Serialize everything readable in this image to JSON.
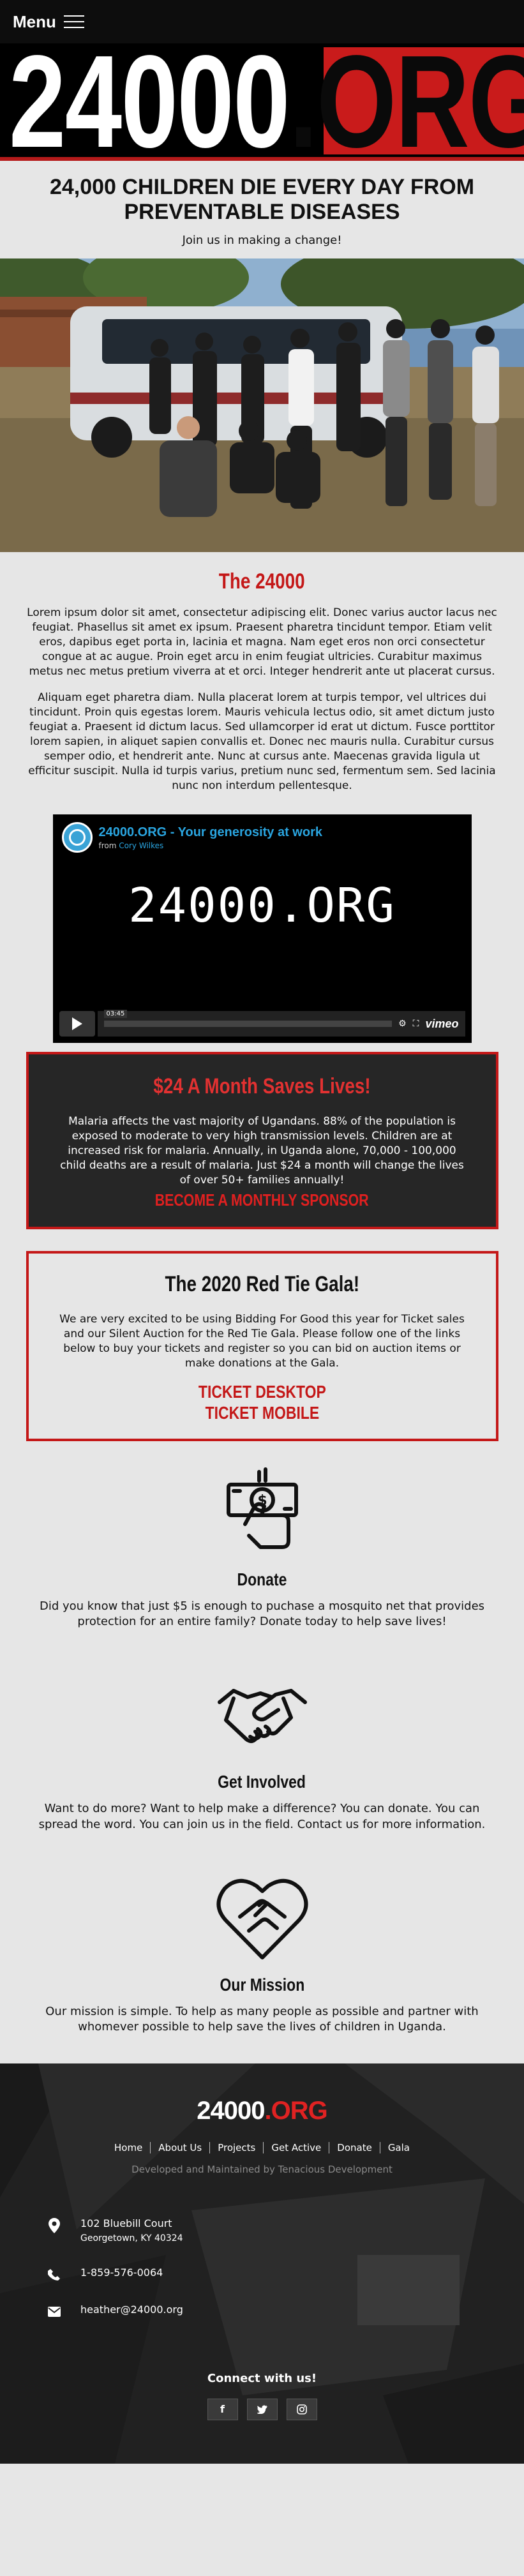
{
  "header": {
    "menu_label": "Menu"
  },
  "logo": {
    "number": "24000",
    "suffix": ".ORG"
  },
  "hero": {
    "headline": "24,000 CHILDREN DIE EVERY DAY FROM PREVENTABLE DISEASES",
    "tagline": "Join us in making a change!"
  },
  "about": {
    "title": "The 24000",
    "paragraph1": "Lorem ipsum dolor sit amet, consectetur adipiscing elit. Donec varius auctor lacus nec feugiat. Phasellus sit amet ex ipsum. Praesent pharetra tincidunt tempor. Etiam velit eros, dapibus eget porta in, lacinia et magna. Nam eget eros non orci consectetur congue at ac augue. Proin eget arcu in enim feugiat ultricies. Curabitur maximus metus nec metus pretium viverra at et orci. Integer hendrerit ante ut placerat cursus.",
    "paragraph2": "Aliquam eget pharetra diam. Nulla placerat lorem at turpis tempor, vel ultrices dui tincidunt. Proin quis egestas lorem. Mauris vehicula lectus odio, sit amet dictum justo feugiat a. Praesent id dictum lacus. Sed ullamcorper id erat ut dictum. Fusce porttitor lorem sapien, in aliquet sapien convallis et. Donec nec mauris nulla. Curabitur cursus semper odio, et hendrerit ante. Nunc at cursus ante. Maecenas gravida ligula ut efficitur suscipit. Nulla id turpis varius, pretium nunc sed, fermentum sem. Sed lacinia nunc non interdum pellentesque."
  },
  "video": {
    "title": "24000.ORG - Your generosity at work",
    "from_label": "from",
    "author": "Cory Wilkes",
    "screen_text": "24000.ORG",
    "time": "03:45",
    "brand": "vimeo"
  },
  "sponsor_box": {
    "title": "$24 A Month Saves Lives!",
    "text": "Malaria affects the vast majority of Ugandans. 88% of the population is exposed to moderate to very high transmission levels. Children are at increased risk for malaria. Annually, in Uganda alone, 70,000 - 100,000 child deaths are a result of malaria. Just $24 a month will change the lives of over 50+ families annually!",
    "cta": "BECOME A MONTHLY SPONSOR"
  },
  "gala_box": {
    "title": "The 2020 Red Tie Gala!",
    "text": "We are very excited to be using Bidding For Good this year for Ticket sales and our Silent Auction for the Red Tie Gala. Please follow one of the links below to buy your tickets and register so you can bid on auction items or make donations at the Gala.",
    "link_desktop": "TICKET DESKTOP",
    "link_mobile": "TICKET MOBILE"
  },
  "features": [
    {
      "icon": "donate-money-hand-icon",
      "title": "Donate",
      "text": "Did you know that just $5 is enough to puchase a mosquito net that provides protection for an entire family? Donate today to help save lives!"
    },
    {
      "icon": "handshake-icon",
      "title": "Get Involved",
      "text": "Want to do more? Want to help make a difference? You can donate. You can spread the word. You can join us in the field. Contact us for more information."
    },
    {
      "icon": "heart-hands-icon",
      "title": "Our Mission",
      "text": "Our mission is simple. To help as many people as possible and partner with whomever possible to help save the lives of children in Uganda."
    }
  ],
  "footer": {
    "logo_number": "24000",
    "logo_suffix": ".ORG",
    "nav": [
      "Home",
      "About Us",
      "Projects",
      "Get Active",
      "Donate",
      "Gala"
    ],
    "developer": "Developed and Maintained by Tenacious Development",
    "address_line1": "102 Bluebill Court",
    "address_line2": "Georgetown, KY 40324",
    "phone": "1-859-576-0064",
    "email": "heather@24000.org",
    "connect": "Connect with us!",
    "social": [
      "facebook-icon",
      "twitter-icon",
      "instagram-icon"
    ]
  },
  "colors": {
    "accent_red": "#c41818",
    "dark": "#262626",
    "background": "#e6e6e6"
  }
}
